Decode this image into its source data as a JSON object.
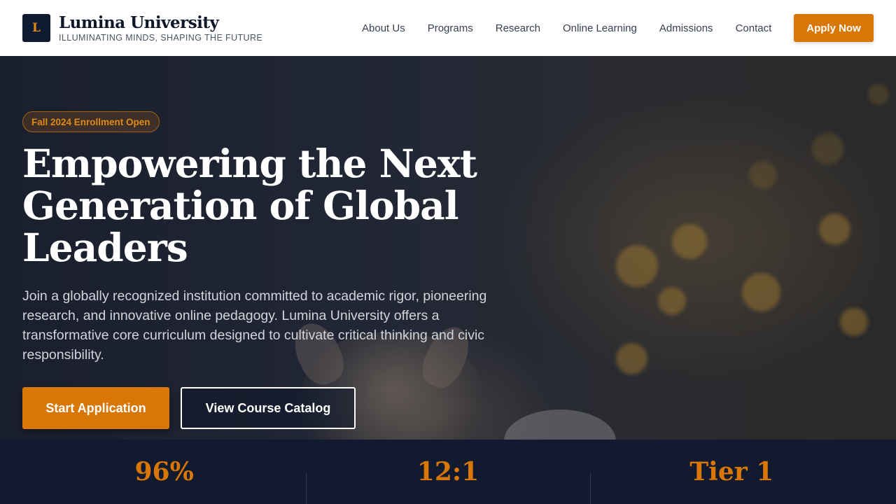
{
  "header": {
    "logo_letter": "L",
    "brand_name": "Lumina University",
    "tagline": "ILLUMINATING MINDS, SHAPING THE FUTURE",
    "nav": [
      "About Us",
      "Programs",
      "Research",
      "Online Learning",
      "Admissions",
      "Contact"
    ],
    "apply_label": "Apply Now"
  },
  "hero": {
    "badge": "Fall 2024 Enrollment Open",
    "title_lines": [
      "Empowering the Next",
      "Generation of Global",
      "Leaders"
    ],
    "description": "Join a globally recognized institution committed to academic rigor, pioneering research, and innovative online pedagogy. Lumina University offers a transformative core curriculum designed to cultivate critical thinking and civic responsibility.",
    "primary_cta": "Start Application",
    "secondary_cta": "View Course Catalog"
  },
  "stats": [
    {
      "value": "96%"
    },
    {
      "value": "12:1"
    },
    {
      "value": "Tier 1"
    }
  ],
  "colors": {
    "accent": "#d97706",
    "navy": "#0f172a",
    "stats_bg": "#111a2e"
  }
}
